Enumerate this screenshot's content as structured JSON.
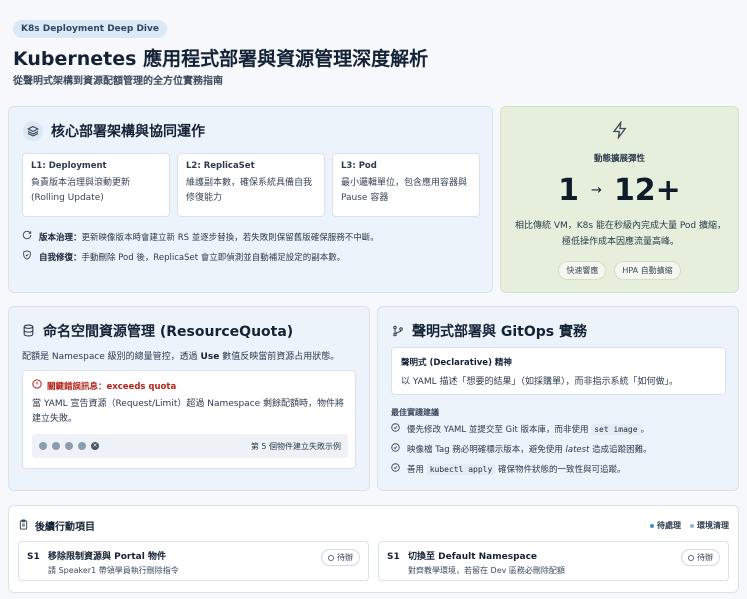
{
  "header": {
    "badge": "K8s Deployment Deep Dive",
    "title": "Kubernetes 應用程式部署與資源管理深度解析",
    "subtitle": "從聲明式架構到資源配額管理的全方位實務指南"
  },
  "core": {
    "title": "核心部署架構與協同運作",
    "icon": "layers-icon",
    "layers": [
      {
        "title": "L1: Deployment",
        "desc": "負責版本治理與滾動更新 (Rolling Update)"
      },
      {
        "title": "L2: ReplicaSet",
        "desc": "維護副本數，確保系統具備自我修復能力"
      },
      {
        "title": "L3: Pod",
        "desc": "最小邏輯單位，包含應用容器與 Pause 容器"
      }
    ],
    "bullets": [
      {
        "icon": "refresh-icon",
        "label": "版本治理：",
        "text": "更新映像版本時會建立新 RS 並逐步替換，若失敗則保留舊版確保服務不中斷。"
      },
      {
        "icon": "shield-icon",
        "label": "自我修復：",
        "text": "手動刪除 Pod 後，ReplicaSet 會立即偵測並自動補足設定的副本數。"
      }
    ]
  },
  "elastic": {
    "icon": "lightning-icon",
    "label": "動態擴展彈性",
    "from": "1",
    "to": "12+",
    "desc": "相比傳統 VM，K8s 能在秒級內完成大量 Pod 擴縮，極低操作成本因應流量高峰。",
    "tags": [
      "快速響應",
      "HPA 自動擴縮"
    ]
  },
  "quota": {
    "title": "命名空間資源管理 (ResourceQuota)",
    "icon": "database-icon",
    "desc_pre": "配額是 Namespace 級別的總量管控，透過 ",
    "desc_bold": "Use",
    "desc_post": " 數值反映當前資源占用狀態。",
    "error_title": "關鍵錯誤訊息：exceeds quota",
    "error_text": "當 YAML 宣告資源（Request/Limit）超過 Namespace 剩餘配額時，物件將建立失敗。",
    "progress_label": "第 5 個物件建立失敗示例"
  },
  "gitops": {
    "title": "聲明式部署與 GitOps 實務",
    "icon": "branch-icon",
    "box_title": "聲明式 (Declarative) 精神",
    "box_desc": "以 YAML 描述「想要的結果」（如採購單），而非指示系統「如何做」。",
    "practice_title": "最佳實踐建議",
    "practices": [
      {
        "pre": "優先修改 YAML 並提交至 Git 版本庫，而非使用 ",
        "code": "set image",
        "post": "。"
      },
      {
        "pre": "映像檔 Tag 務必明確標示版本，避免使用 ",
        "em": "latest",
        "post": " 造成追蹤困難。"
      },
      {
        "pre": "善用 ",
        "code": "kubectl apply",
        "post": " 確保物件狀態的一致性與可追蹤。"
      }
    ]
  },
  "actions": {
    "title": "後續行動項目",
    "icon": "clipboard-icon",
    "legend": [
      "待處理",
      "環境清理"
    ],
    "items": [
      {
        "step": "S1",
        "title": "移除限制資源與 Portal 物件",
        "desc": "請 Speaker1 帶領學員執行刪除指令",
        "status": "待辦"
      },
      {
        "step": "S1",
        "title": "切換至 Default Namespace",
        "desc": "對齊教學環境，若留在 Dev 區務必刪除配額",
        "status": "待辦"
      }
    ]
  }
}
